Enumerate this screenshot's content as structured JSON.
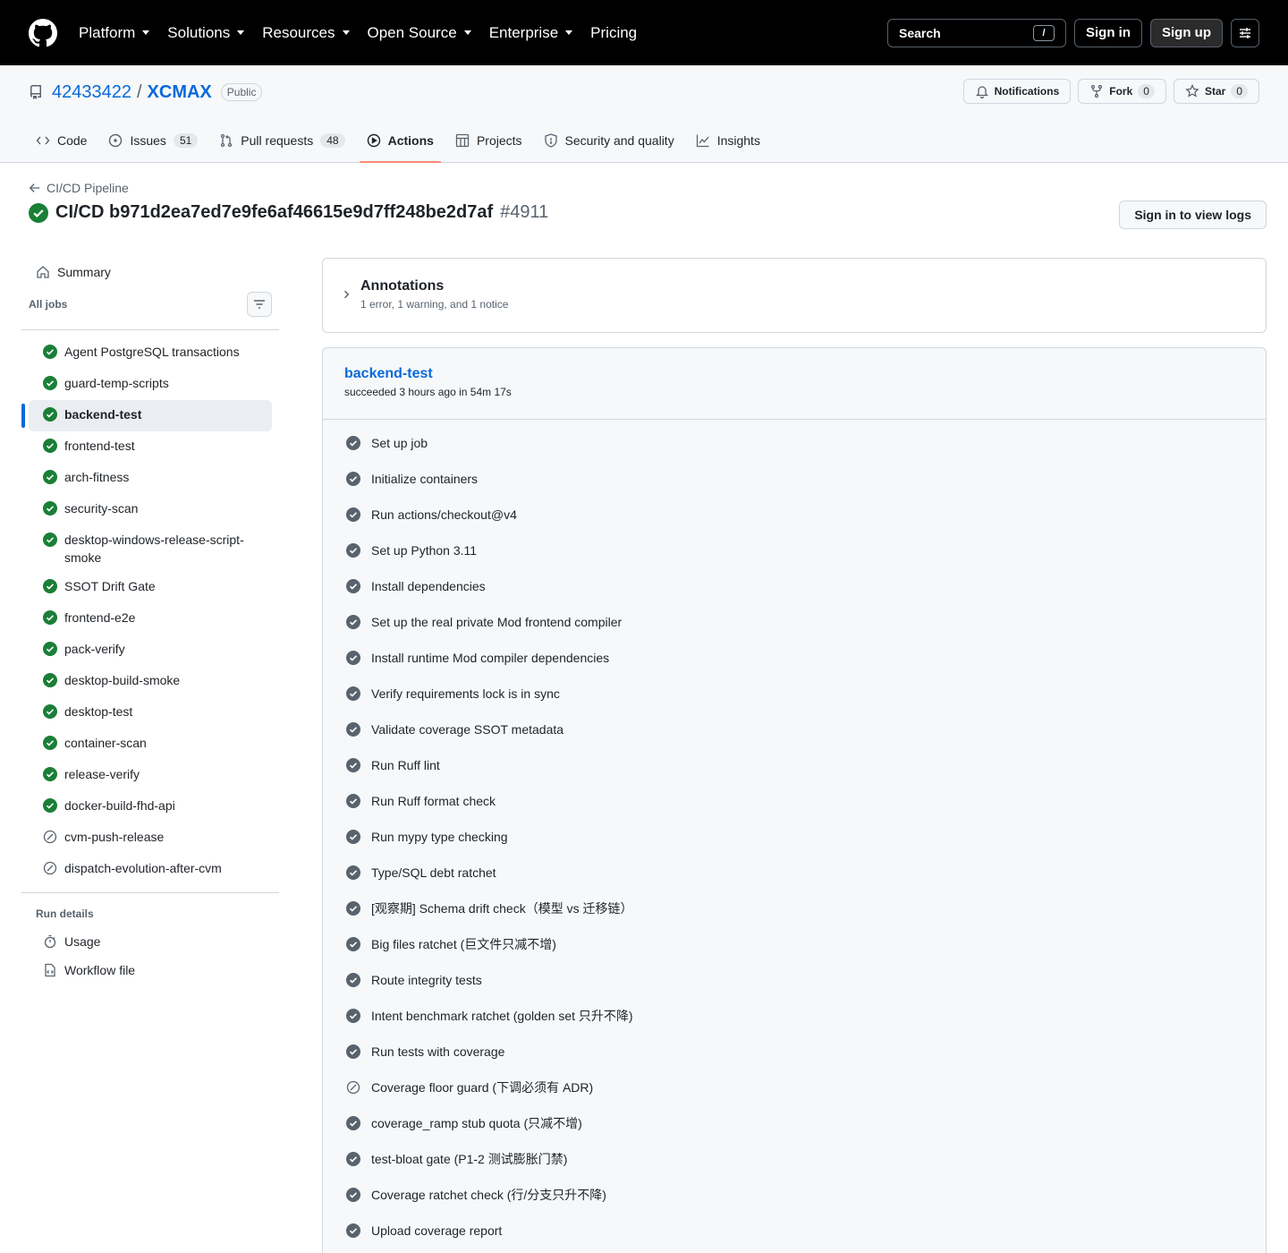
{
  "nav": {
    "items": [
      "Platform",
      "Solutions",
      "Resources",
      "Open Source",
      "Enterprise"
    ],
    "pricing": "Pricing",
    "search_label": "Search",
    "search_shortcut": "/",
    "sign_in": "Sign in",
    "sign_up": "Sign up"
  },
  "repo": {
    "owner": "42433422",
    "separator": "/",
    "name": "XCMAX",
    "visibility": "Public",
    "notifications": "Notifications",
    "fork_label": "Fork",
    "fork_count": "0",
    "star_label": "Star",
    "star_count": "0"
  },
  "tabs": [
    {
      "label": "Code",
      "count": ""
    },
    {
      "label": "Issues",
      "count": "51"
    },
    {
      "label": "Pull requests",
      "count": "48"
    },
    {
      "label": "Actions",
      "count": ""
    },
    {
      "label": "Projects",
      "count": ""
    },
    {
      "label": "Security and quality",
      "count": ""
    },
    {
      "label": "Insights",
      "count": ""
    }
  ],
  "run": {
    "back_label": "CI/CD Pipeline",
    "title": "CI/CD b971d2ea7ed7e9fe6af46615e9d7ff248be2d7af",
    "number": "#4911",
    "view_logs": "Sign in to view logs"
  },
  "sidebar": {
    "summary": "Summary",
    "all_jobs": "All jobs",
    "jobs": [
      {
        "name": "Agent PostgreSQL transactions",
        "status": "success"
      },
      {
        "name": "guard-temp-scripts",
        "status": "success"
      },
      {
        "name": "backend-test",
        "status": "success"
      },
      {
        "name": "frontend-test",
        "status": "success"
      },
      {
        "name": "arch-fitness",
        "status": "success"
      },
      {
        "name": "security-scan",
        "status": "success"
      },
      {
        "name": "desktop-windows-release-script-smoke",
        "status": "success"
      },
      {
        "name": "SSOT Drift Gate",
        "status": "success"
      },
      {
        "name": "frontend-e2e",
        "status": "success"
      },
      {
        "name": "pack-verify",
        "status": "success"
      },
      {
        "name": "desktop-build-smoke",
        "status": "success"
      },
      {
        "name": "desktop-test",
        "status": "success"
      },
      {
        "name": "container-scan",
        "status": "success"
      },
      {
        "name": "release-verify",
        "status": "success"
      },
      {
        "name": "docker-build-fhd-api",
        "status": "success"
      },
      {
        "name": "cvm-push-release",
        "status": "skipped"
      },
      {
        "name": "dispatch-evolution-after-cvm",
        "status": "skipped"
      }
    ],
    "run_details": "Run details",
    "usage": "Usage",
    "workflow_file": "Workflow file"
  },
  "annotations": {
    "title": "Annotations",
    "summary": "1 error, 1 warning, and 1 notice"
  },
  "job": {
    "name": "backend-test",
    "status": "succeeded 3 hours ago in 54m 17s",
    "steps": [
      {
        "name": "Set up job",
        "status": "success"
      },
      {
        "name": "Initialize containers",
        "status": "success"
      },
      {
        "name": "Run actions/checkout@v4",
        "status": "success"
      },
      {
        "name": "Set up Python 3.11",
        "status": "success"
      },
      {
        "name": "Install dependencies",
        "status": "success"
      },
      {
        "name": "Set up the real private Mod frontend compiler",
        "status": "success"
      },
      {
        "name": "Install runtime Mod compiler dependencies",
        "status": "success"
      },
      {
        "name": "Verify requirements lock is in sync",
        "status": "success"
      },
      {
        "name": "Validate coverage SSOT metadata",
        "status": "success"
      },
      {
        "name": "Run Ruff lint",
        "status": "success"
      },
      {
        "name": "Run Ruff format check",
        "status": "success"
      },
      {
        "name": "Run mypy type checking",
        "status": "success"
      },
      {
        "name": "Type/SQL debt ratchet",
        "status": "success"
      },
      {
        "name": "[观察期] Schema drift check（模型 vs 迁移链）",
        "status": "success"
      },
      {
        "name": "Big files ratchet (巨文件只减不增)",
        "status": "success"
      },
      {
        "name": "Route integrity tests",
        "status": "success"
      },
      {
        "name": "Intent benchmark ratchet (golden set 只升不降)",
        "status": "success"
      },
      {
        "name": "Run tests with coverage",
        "status": "success"
      },
      {
        "name": "Coverage floor guard (下调必须有 ADR)",
        "status": "skipped"
      },
      {
        "name": "coverage_ramp stub quota (只减不增)",
        "status": "success"
      },
      {
        "name": "test-bloat gate (P1-2 测试膨胀门禁)",
        "status": "success"
      },
      {
        "name": "Coverage ratchet check (行/分支只升不降)",
        "status": "success"
      },
      {
        "name": "Upload coverage report",
        "status": "success"
      }
    ]
  },
  "colors": {
    "success": "#1a7f37",
    "step_success": "#59636e",
    "link": "#0969da",
    "active_tab": "#fd8c73"
  }
}
